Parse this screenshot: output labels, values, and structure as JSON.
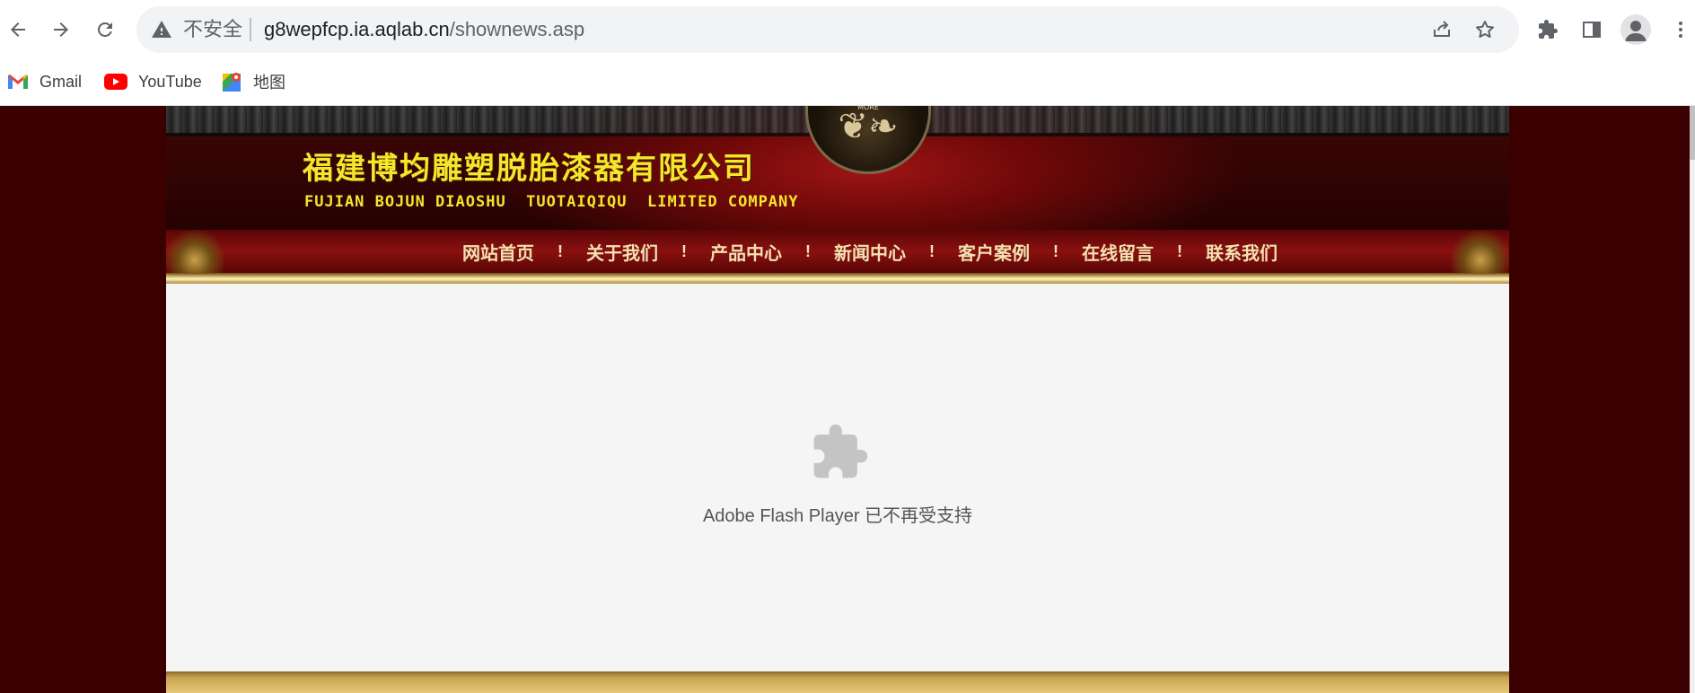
{
  "browser": {
    "security_label": "不安全",
    "url_host": "g8wepfcp.ia.aqlab.cn",
    "url_path": "/shownews.asp"
  },
  "bookmarks": [
    {
      "label": "Gmail",
      "icon": "gmail-icon"
    },
    {
      "label": "YouTube",
      "icon": "youtube-icon"
    },
    {
      "label": "地图",
      "icon": "maps-icon"
    }
  ],
  "site": {
    "company_cn": "福建博均雕塑脱胎漆器有限公司",
    "company_en": "FUJIAN BOJUN DIAOSHU  TUOTAIQIQU  LIMITED COMPANY",
    "nav": [
      {
        "label": "网站首页"
      },
      {
        "label": "关于我们"
      },
      {
        "label": "产品中心"
      },
      {
        "label": "新闻中心"
      },
      {
        "label": "客户案例"
      },
      {
        "label": "在线留言"
      },
      {
        "label": "联系我们"
      }
    ],
    "nav_separator": "!",
    "plugin_message": "Adobe Flash Player 已不再受支持"
  },
  "colors": {
    "page_background": "#3a0000",
    "title_yellow": "#f4e62a",
    "nav_text": "#f2e2b0",
    "content_background": "#f5f5f5"
  }
}
